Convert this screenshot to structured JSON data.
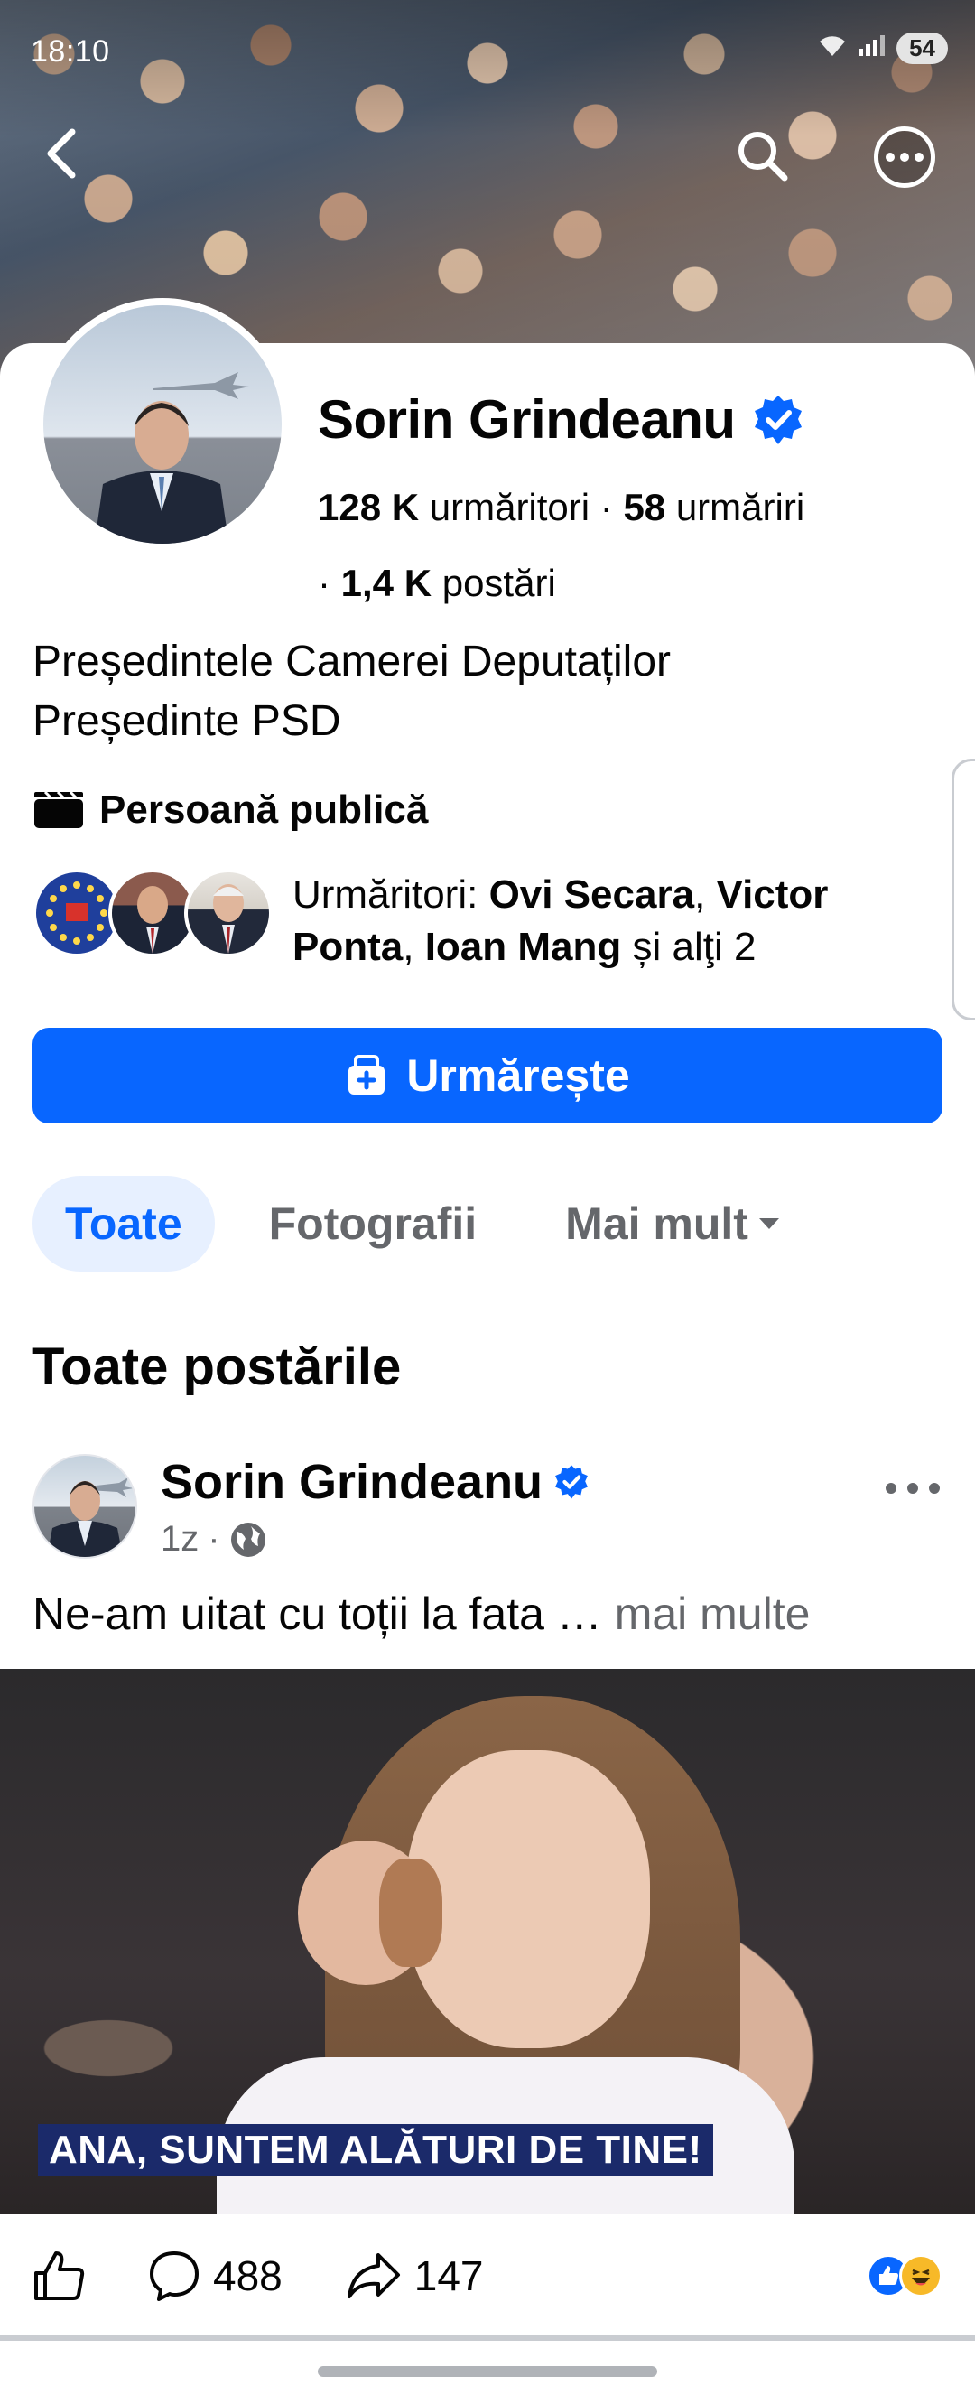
{
  "status_bar": {
    "time": "18:10",
    "battery": "54"
  },
  "header": {
    "back_icon": "chevron-left-icon",
    "search_icon": "search-icon",
    "more_icon": "more-horizontal-icon"
  },
  "profile": {
    "name": "Sorin Grindeanu",
    "verified": true,
    "followers_count": "128 K",
    "followers_label": "urmăritori",
    "following_count": "58",
    "following_label": "urmăriri",
    "posts_count": "1,4 K",
    "posts_label": "postări",
    "bio_line1": "Președintele Camerei Deputaților",
    "bio_line2": "Președinte PSD",
    "category": "Persoană publică",
    "mutual_followers": {
      "prefix": "Urmăritori: ",
      "name1": "Ovi Secara",
      "name2": "Victor Ponta",
      "name3": "Ioan Mang",
      "suffix": " și alţi 2"
    }
  },
  "follow_button": {
    "label": "Urmărește"
  },
  "tabs": [
    {
      "label": "Toate",
      "active": true
    },
    {
      "label": "Fotografii",
      "active": false
    },
    {
      "label": "Mai mult",
      "active": false
    }
  ],
  "section_title": "Toate postările",
  "post": {
    "author": "Sorin Grindeanu",
    "time": "1z",
    "audience_icon": "globe-icon",
    "text": "Ne-am uitat cu toții la fata … ",
    "see_more": "mai multe",
    "media_caption": "ANA, SUNTEM ALĂTURI DE TINE!",
    "comments": "488",
    "shares": "147"
  },
  "colors": {
    "accent": "#0866ff",
    "tab_active_bg": "#e7f0ff",
    "secondary_text": "#65676b"
  }
}
